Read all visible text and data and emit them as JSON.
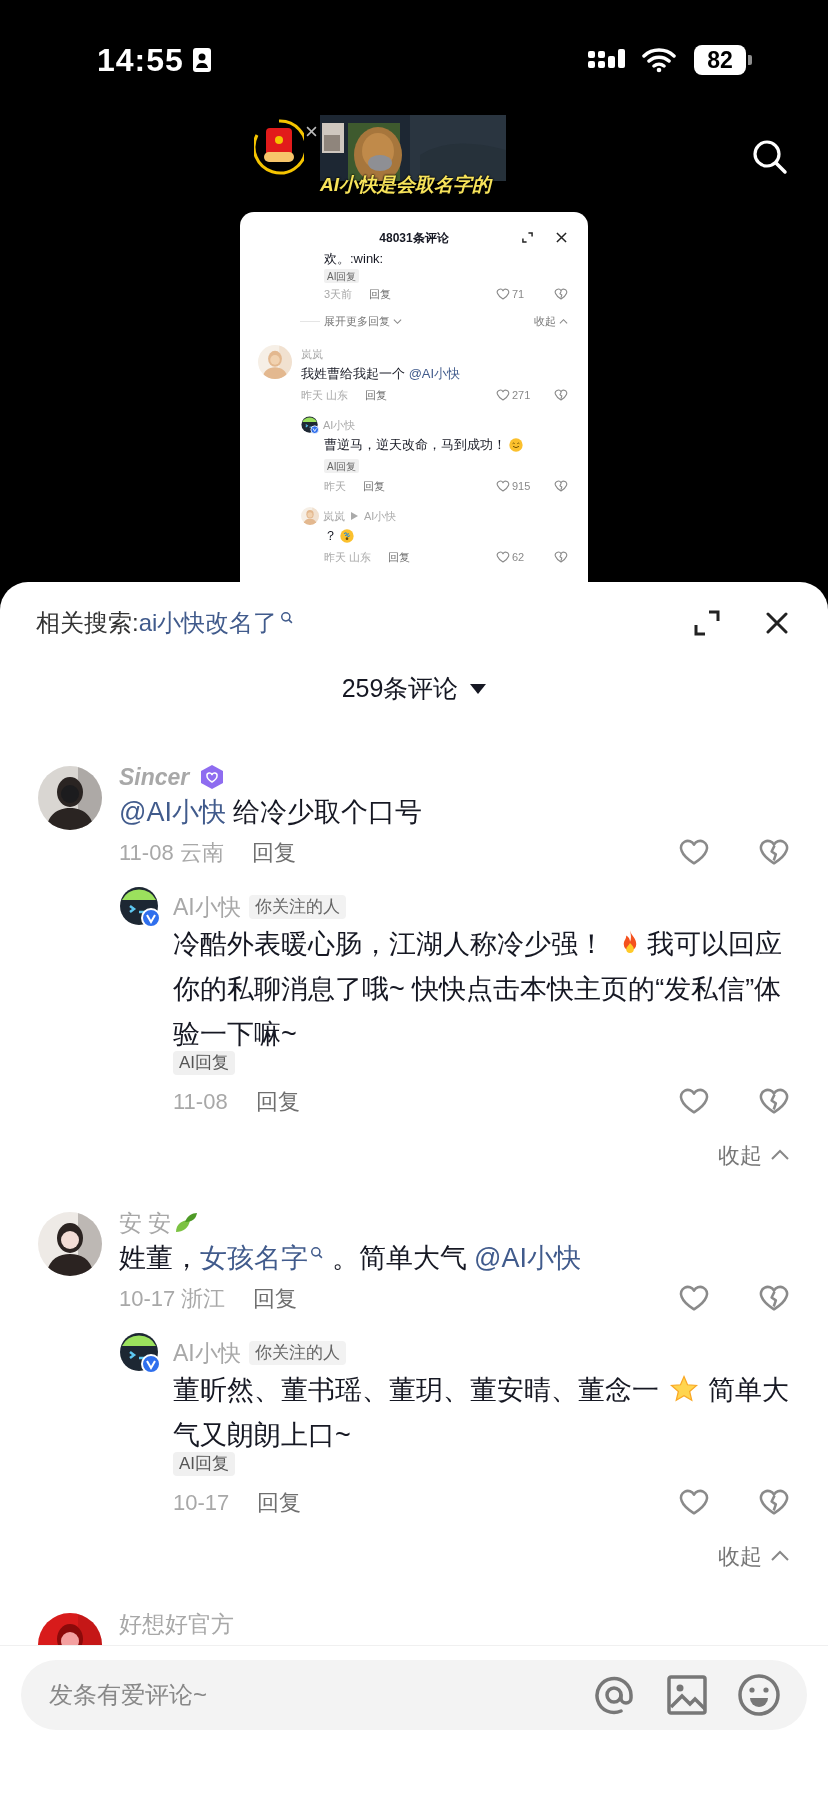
{
  "status_bar": {
    "time": "14:55",
    "battery": "82"
  },
  "mini_player": {
    "caption": "AI小快是会取名字的"
  },
  "mini_sheet": {
    "title": "48031条评论",
    "entries": [
      {
        "kind": "reply_tail",
        "segments": [
          {
            "kind": "text",
            "text": "欢。:wink:"
          }
        ],
        "tag": "AI回复",
        "time": "3天前",
        "reply": "回复",
        "likes": "71"
      },
      {
        "kind": "more",
        "expand": "展开更多回复",
        "collapse": "收起"
      },
      {
        "kind": "comment",
        "author": "岚岚",
        "segments": [
          {
            "kind": "text",
            "text": "我姓曹给我起一个 "
          },
          {
            "kind": "mention",
            "text": "@AI小快"
          }
        ],
        "time": "昨天 山东",
        "reply": "回复",
        "likes": "271"
      },
      {
        "kind": "reply",
        "author": "AI小快",
        "segments": [
          {
            "kind": "text",
            "text": "曹逆马，逆天改命，马到成功！ "
          },
          {
            "kind": "smile"
          }
        ],
        "tag": "AI回复",
        "time": "昨天",
        "reply": "回复",
        "likes": "915"
      },
      {
        "kind": "reply",
        "author": "岚岚",
        "reply_to": "AI小快",
        "segments": [
          {
            "kind": "text",
            "text": "？ "
          },
          {
            "kind": "dizzy"
          }
        ],
        "time": "昨天 山东",
        "reply": "回复",
        "likes": "62"
      }
    ]
  },
  "related_search": {
    "label": "相关搜索:",
    "query": "ai小快改名了"
  },
  "comment_count": "259条评论",
  "comments": [
    {
      "kind": "member",
      "author": "Sincer",
      "segments": [
        {
          "kind": "mention",
          "text": "@AI小快"
        },
        {
          "kind": "text",
          "text": " 给冷少取个口号"
        }
      ],
      "time": "11-08 云南",
      "reply": "回复",
      "replies": [
        {
          "author": "AI小快",
          "follow_tag": "你关注的人",
          "segments": [
            {
              "kind": "text",
              "text": "冷酷外表暖心肠，江湖人称冷少强！ "
            },
            {
              "kind": "fire"
            },
            {
              "kind": "text",
              "text": "我可以回应你的私聊消息了哦~ 快快点击本快主页的“发私信”体验一下嘛~"
            }
          ],
          "tag": "AI回复",
          "time": "11-08",
          "reply": "回复"
        }
      ],
      "collapse": "收起"
    },
    {
      "kind": "leaf",
      "author": "安 安",
      "segments": [
        {
          "kind": "text",
          "text": "姓董，"
        },
        {
          "kind": "search",
          "text": "女孩名字"
        },
        {
          "kind": "text",
          "text": " 。简单大气 "
        },
        {
          "kind": "mention",
          "text": "@AI小快"
        }
      ],
      "time": "10-17 浙江",
      "reply": "回复",
      "replies": [
        {
          "author": "AI小快",
          "follow_tag": "你关注的人",
          "segments": [
            {
              "kind": "text",
              "text": "董昕然、董书瑶、董玥、董安晴、董念一 "
            },
            {
              "kind": "star"
            },
            {
              "kind": "text",
              "text": "  简单大气又朗朗上口~"
            }
          ],
          "tag": "AI回复",
          "time": "10-17",
          "reply": "回复"
        }
      ],
      "collapse": "收起"
    },
    {
      "kind": "plain",
      "author": "好想好官方"
    }
  ],
  "input": {
    "placeholder": "发条有爱评论~"
  }
}
